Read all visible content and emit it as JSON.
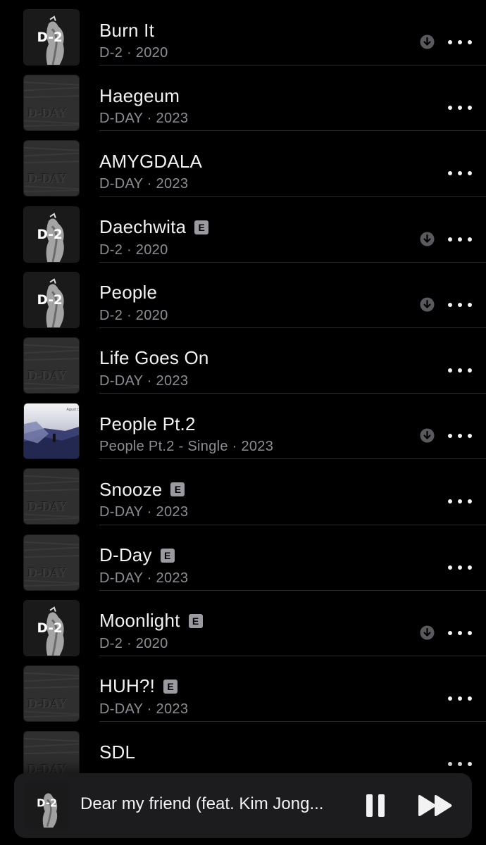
{
  "songs": [
    {
      "title": "Burn It",
      "subtitle": "D-2 · 2020",
      "art": "d2",
      "explicit": false,
      "downloaded": true
    },
    {
      "title": "Haegeum",
      "subtitle": "D-DAY · 2023",
      "art": "dday",
      "explicit": false,
      "downloaded": false
    },
    {
      "title": "AMYGDALA",
      "subtitle": "D-DAY · 2023",
      "art": "dday",
      "explicit": false,
      "downloaded": false
    },
    {
      "title": "Daechwita",
      "subtitle": "D-2 · 2020",
      "art": "d2",
      "explicit": true,
      "downloaded": true
    },
    {
      "title": "People",
      "subtitle": "D-2 · 2020",
      "art": "d2",
      "explicit": false,
      "downloaded": true
    },
    {
      "title": "Life Goes On",
      "subtitle": "D-DAY · 2023",
      "art": "dday",
      "explicit": false,
      "downloaded": false
    },
    {
      "title": "People Pt.2",
      "subtitle": "People Pt.2 - Single · 2023",
      "art": "people2",
      "explicit": false,
      "downloaded": true
    },
    {
      "title": "Snooze",
      "subtitle": "D-DAY · 2023",
      "art": "dday",
      "explicit": true,
      "downloaded": false
    },
    {
      "title": "D-Day",
      "subtitle": "D-DAY · 2023",
      "art": "dday",
      "explicit": true,
      "downloaded": false
    },
    {
      "title": "Moonlight",
      "subtitle": "D-2 · 2020",
      "art": "d2",
      "explicit": true,
      "downloaded": true
    },
    {
      "title": "HUH?!",
      "subtitle": "D-DAY · 2023",
      "art": "dday",
      "explicit": true,
      "downloaded": false
    },
    {
      "title": "SDL",
      "subtitle": "",
      "art": "dday",
      "explicit": false,
      "downloaded": false
    }
  ],
  "explicit_badge": "E",
  "art_labels": {
    "d2": "D-2",
    "dday": "D-DAY",
    "people2": "Agust D"
  },
  "now_playing": {
    "title": "Dear my friend (feat. Kim Jong...",
    "art_label": "D-2",
    "state": "playing"
  },
  "icons": {
    "download": "arrow-down-circle-icon",
    "more": "ellipsis-icon",
    "pause": "pause-icon",
    "skip": "forward-icon"
  },
  "colors": {
    "background": "#000000",
    "text_primary": "#f2f2f2",
    "text_secondary": "#8d8d93",
    "separator": "#2a2a2d",
    "mini_player": "#1c1c1e"
  }
}
